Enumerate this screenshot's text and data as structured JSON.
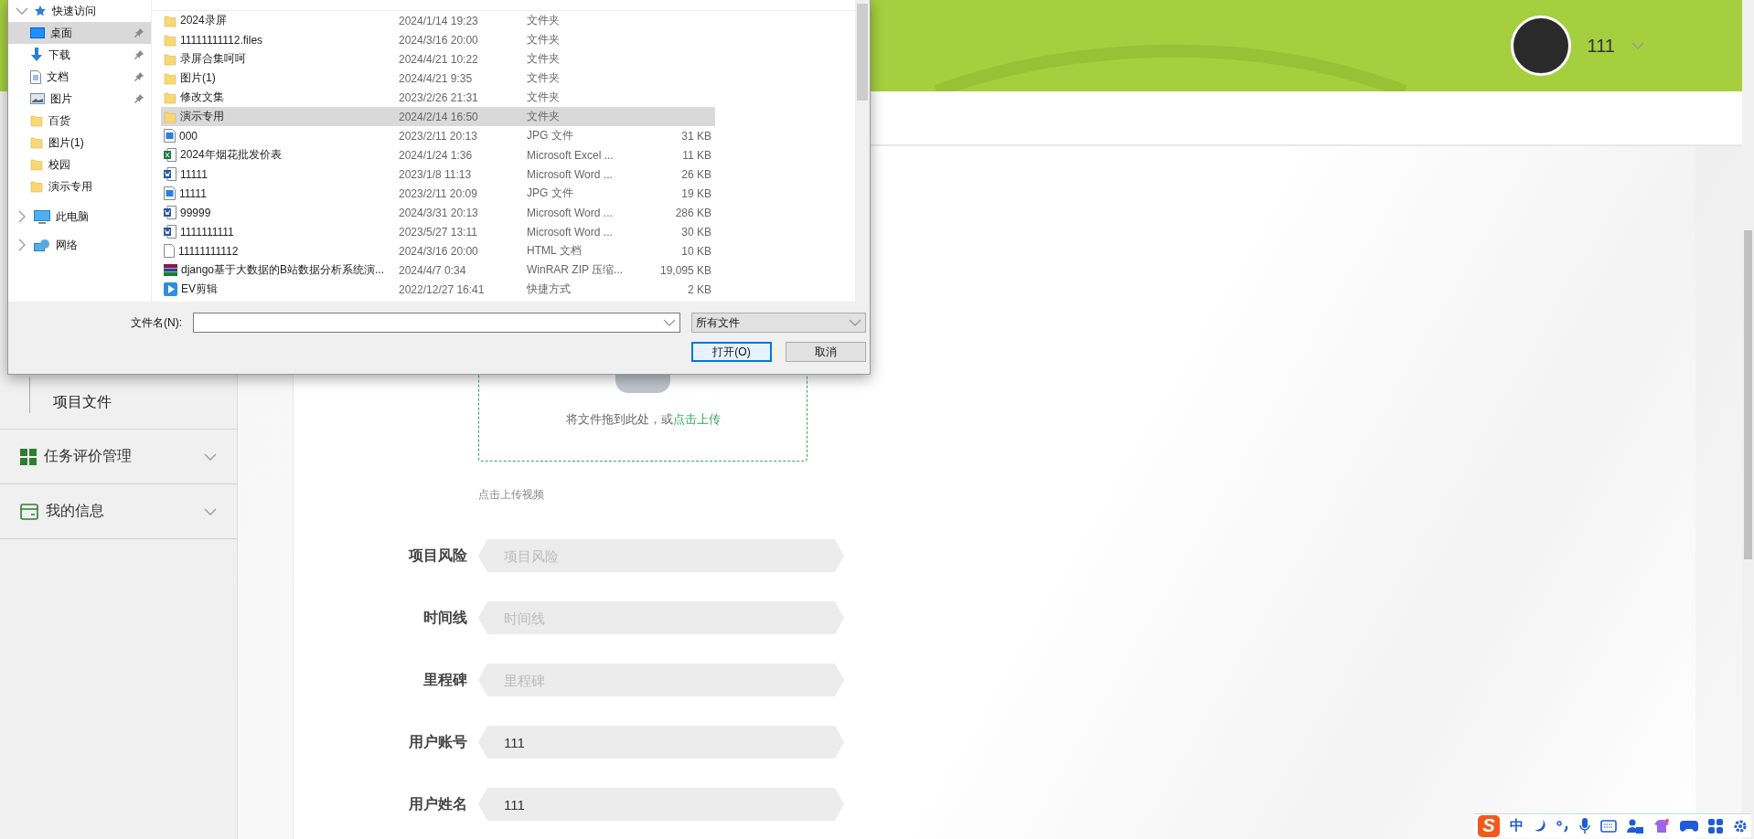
{
  "header": {
    "username": "111"
  },
  "sidebar": {
    "items": [
      {
        "label": "项目文件",
        "kind": "subitem"
      },
      {
        "label": "任务评价管理",
        "kind": "menu"
      },
      {
        "label": "我的信息",
        "kind": "menu"
      }
    ]
  },
  "upload": {
    "hint": "将文件拖到此处，或",
    "link": "点击上传",
    "caption": "点击上传视频"
  },
  "form": {
    "fields": [
      {
        "label": "项目风险",
        "placeholder": "项目风险"
      },
      {
        "label": "时间线",
        "placeholder": "时间线"
      },
      {
        "label": "里程碑",
        "placeholder": "里程碑"
      },
      {
        "label": "用户账号",
        "value": "111"
      },
      {
        "label": "用户姓名",
        "value": "111"
      }
    ]
  },
  "dialog": {
    "nav": [
      {
        "label": "快速访问",
        "kind": "quick",
        "children": [
          {
            "label": "桌面",
            "kind": "desktop",
            "pinned": true,
            "selected": true
          },
          {
            "label": "下载",
            "kind": "download",
            "pinned": true,
            "selected": false
          },
          {
            "label": "文档",
            "kind": "document",
            "pinned": true,
            "selected": false
          },
          {
            "label": "图片",
            "kind": "picture",
            "pinned": true,
            "selected": false
          },
          {
            "label": "百货",
            "kind": "folder",
            "pinned": false,
            "selected": false
          },
          {
            "label": "图片(1)",
            "kind": "folder",
            "pinned": false,
            "selected": false
          },
          {
            "label": "校园",
            "kind": "folder",
            "pinned": false,
            "selected": false
          },
          {
            "label": "演示专用",
            "kind": "folder",
            "pinned": false,
            "selected": false
          }
        ]
      },
      {
        "label": "此电脑",
        "kind": "computer"
      },
      {
        "label": "网络",
        "kind": "network"
      }
    ],
    "files": [
      {
        "name": "2024录屏",
        "date": "2024/1/14 19:23",
        "type": "文件夹",
        "kind": "folder",
        "selected": false
      },
      {
        "name": "11111111112.files",
        "date": "2024/3/16 20:00",
        "type": "文件夹",
        "kind": "folder",
        "selected": false
      },
      {
        "name": "录屏合集呵呵",
        "date": "2024/4/21 10:22",
        "type": "文件夹",
        "kind": "folder",
        "selected": false
      },
      {
        "name": "图片(1)",
        "date": "2024/4/21 9:35",
        "type": "文件夹",
        "kind": "folder",
        "selected": false
      },
      {
        "name": "修改文集",
        "date": "2023/2/26 21:31",
        "type": "文件夹",
        "kind": "folder",
        "selected": false
      },
      {
        "name": "演示专用",
        "date": "2024/2/14 16:50",
        "type": "文件夹",
        "kind": "folder",
        "selected": true
      },
      {
        "name": "000",
        "date": "2023/2/11 20:13",
        "type": "JPG 文件",
        "size": "31 KB",
        "kind": "image",
        "selected": false
      },
      {
        "name": "2024年烟花批发价表",
        "date": "2024/1/24 1:36",
        "type": "Microsoft Excel ...",
        "size": "11 KB",
        "kind": "excel",
        "selected": false
      },
      {
        "name": "11111",
        "date": "2023/1/8 11:13",
        "type": "Microsoft Word ...",
        "size": "26 KB",
        "kind": "word",
        "selected": false
      },
      {
        "name": "11111",
        "date": "2023/2/11 20:09",
        "type": "JPG 文件",
        "size": "19 KB",
        "kind": "image",
        "selected": false
      },
      {
        "name": "99999",
        "date": "2024/3/31 20:13",
        "type": "Microsoft Word ...",
        "size": "286 KB",
        "kind": "word",
        "selected": false
      },
      {
        "name": "1111111111",
        "date": "2023/5/27 13:11",
        "type": "Microsoft Word ...",
        "size": "30 KB",
        "kind": "word",
        "selected": false
      },
      {
        "name": "11111111112",
        "date": "2024/3/16 20:00",
        "type": "HTML 文档",
        "size": "10 KB",
        "kind": "html",
        "selected": false
      },
      {
        "name": "django基于大数据的B站数据分析系统演...",
        "date": "2024/4/7 0:34",
        "type": "WinRAR ZIP 压缩...",
        "size": "19,095 KB",
        "kind": "archive",
        "selected": false
      },
      {
        "name": "EV剪辑",
        "date": "2022/12/27 16:41",
        "type": "快捷方式",
        "size": "2 KB",
        "kind": "shortcut",
        "selected": false
      }
    ],
    "filename_label": "文件名(N):",
    "filter": "所有文件",
    "buttons": [
      {
        "label": "打开(O)",
        "primary": true
      },
      {
        "label": "取消",
        "primary": false
      }
    ]
  },
  "tray": {
    "logo": "S",
    "ime": "中"
  }
}
